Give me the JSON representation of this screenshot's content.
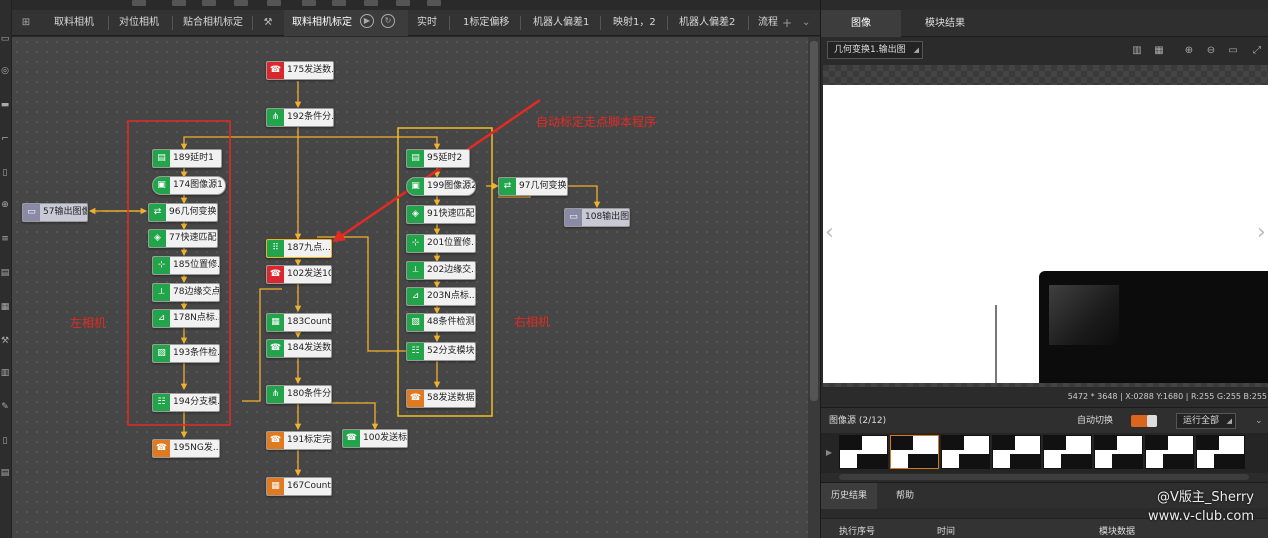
{
  "tabs": [
    {
      "label": "取料相机",
      "active": false
    },
    {
      "label": "对位相机",
      "active": false
    },
    {
      "label": "贴合相机标定",
      "active": false
    },
    {
      "label": "取料相机标定",
      "active": true
    },
    {
      "label": "实时",
      "active": false
    },
    {
      "label": "1标定偏移",
      "active": false
    },
    {
      "label": "机器人偏差1",
      "active": false
    },
    {
      "label": "映射1，2",
      "active": false
    },
    {
      "label": "机器人偏差2",
      "active": false
    },
    {
      "label": "流程",
      "active": false
    }
  ],
  "tab_add": "+",
  "tab_more": "⌄",
  "nodes": [
    {
      "id": "n175",
      "label": "175发送数...",
      "icon": "send-icon",
      "icolor": "#d9272e"
    },
    {
      "id": "n192",
      "label": "192条件分...",
      "icon": "branch-icon",
      "icolor": "#22a54a"
    },
    {
      "id": "n189",
      "label": "189延时1",
      "icon": "delay-icon",
      "icolor": "#22a54a"
    },
    {
      "id": "n174",
      "label": "174图像源1",
      "icon": "image-source-icon",
      "icolor": "#22a54a"
    },
    {
      "id": "n96",
      "label": "96几何变换1",
      "icon": "geometry-transform-icon",
      "icolor": "#22a54a"
    },
    {
      "id": "n77",
      "label": "77快速匹配1",
      "icon": "fast-match-icon",
      "icolor": "#22a54a"
    },
    {
      "id": "n185",
      "label": "185位置修...",
      "icon": "position-fix-icon",
      "icolor": "#22a54a"
    },
    {
      "id": "n78",
      "label": "78边缘交点2",
      "icon": "edge-intersection-icon",
      "icolor": "#22a54a"
    },
    {
      "id": "n178",
      "label": "178N点标...",
      "icon": "n-point-calib-icon",
      "icolor": "#22a54a"
    },
    {
      "id": "n193",
      "label": "193条件检...",
      "icon": "condition-check-icon",
      "icolor": "#22a54a"
    },
    {
      "id": "n194",
      "label": "194分支模...",
      "icon": "branch-module-icon",
      "icolor": "#22a54a"
    },
    {
      "id": "n195",
      "label": "195NG发...",
      "icon": "send-icon",
      "icolor": "#e07a20"
    },
    {
      "id": "n57",
      "label": "57输出图像1",
      "icon": "output-image-icon",
      "icolor": "#8a8aa6"
    },
    {
      "id": "n187",
      "label": "187九点...",
      "icon": "nine-point-icon",
      "icolor": "#22a54a"
    },
    {
      "id": "n102",
      "label": "102发送10...",
      "icon": "send-icon",
      "icolor": "#d9272e"
    },
    {
      "id": "n183",
      "label": "183Count...",
      "icon": "counter-icon",
      "icolor": "#22a54a"
    },
    {
      "id": "n184",
      "label": "184发送数...",
      "icon": "send-icon",
      "icolor": "#22a54a"
    },
    {
      "id": "n180",
      "label": "180条件分...",
      "icon": "branch-icon",
      "icolor": "#22a54a"
    },
    {
      "id": "n191",
      "label": "191标定完...",
      "icon": "send-icon",
      "icolor": "#e07a20"
    },
    {
      "id": "n100",
      "label": "100发送标...",
      "icon": "send-icon",
      "icolor": "#22a54a"
    },
    {
      "id": "n167",
      "label": "167Count...",
      "icon": "counter-icon",
      "icolor": "#e07a20"
    },
    {
      "id": "n95",
      "label": "95延时2",
      "icon": "delay-icon",
      "icolor": "#22a54a"
    },
    {
      "id": "n199",
      "label": "199图像源2",
      "icon": "image-source-icon",
      "icolor": "#22a54a"
    },
    {
      "id": "n97",
      "label": "97几何变换2",
      "icon": "geometry-transform-icon",
      "icolor": "#22a54a"
    },
    {
      "id": "n108",
      "label": "108输出图...",
      "icon": "output-image-icon",
      "icolor": "#8a8aa6"
    },
    {
      "id": "n91",
      "label": "91快速匹配2",
      "icon": "fast-match-icon",
      "icolor": "#22a54a"
    },
    {
      "id": "n201",
      "label": "201位置修...",
      "icon": "position-fix-icon",
      "icolor": "#22a54a"
    },
    {
      "id": "n202",
      "label": "202边缘交...",
      "icon": "edge-intersection-icon",
      "icolor": "#22a54a"
    },
    {
      "id": "n203",
      "label": "203N点标...",
      "icon": "n-point-calib-icon",
      "icolor": "#22a54a"
    },
    {
      "id": "n48",
      "label": "48条件检测2",
      "icon": "condition-check-icon",
      "icolor": "#22a54a"
    },
    {
      "id": "n52",
      "label": "52分支模块1",
      "icon": "branch-module-icon",
      "icolor": "#22a54a"
    },
    {
      "id": "n58",
      "label": "58发送数据5",
      "icon": "send-icon",
      "icolor": "#e07a20"
    }
  ],
  "annotations": {
    "left_camera": "左相机",
    "right_camera": "右相机",
    "auto_calib": "自动标定走点脚本程序"
  },
  "right_panel": {
    "tabs": [
      {
        "label": "图像",
        "active": true
      },
      {
        "label": "模块结果",
        "active": false
      }
    ],
    "image_select": "几何变换1.输出图",
    "status_text": "5472 * 3648  |  X:0288  Y:1680  |  R:255  G:255  B:255",
    "image_source_label": "图像源 (2/12)",
    "auto_switch_label": "自动切换",
    "run_all_label": "运行全部",
    "bottom_tabs": [
      {
        "label": "历史结果",
        "active": true
      },
      {
        "label": "帮助",
        "active": false
      }
    ],
    "table_headers": [
      "执行序号",
      "时间",
      "模块数据"
    ]
  },
  "watermark": {
    "line1": "@V版主_Sherry",
    "line2": "www.v-club.com"
  },
  "colors": {
    "accent": "#f0b030",
    "annotation_red": "#e42a22",
    "toggle_on": "#d9661c"
  }
}
